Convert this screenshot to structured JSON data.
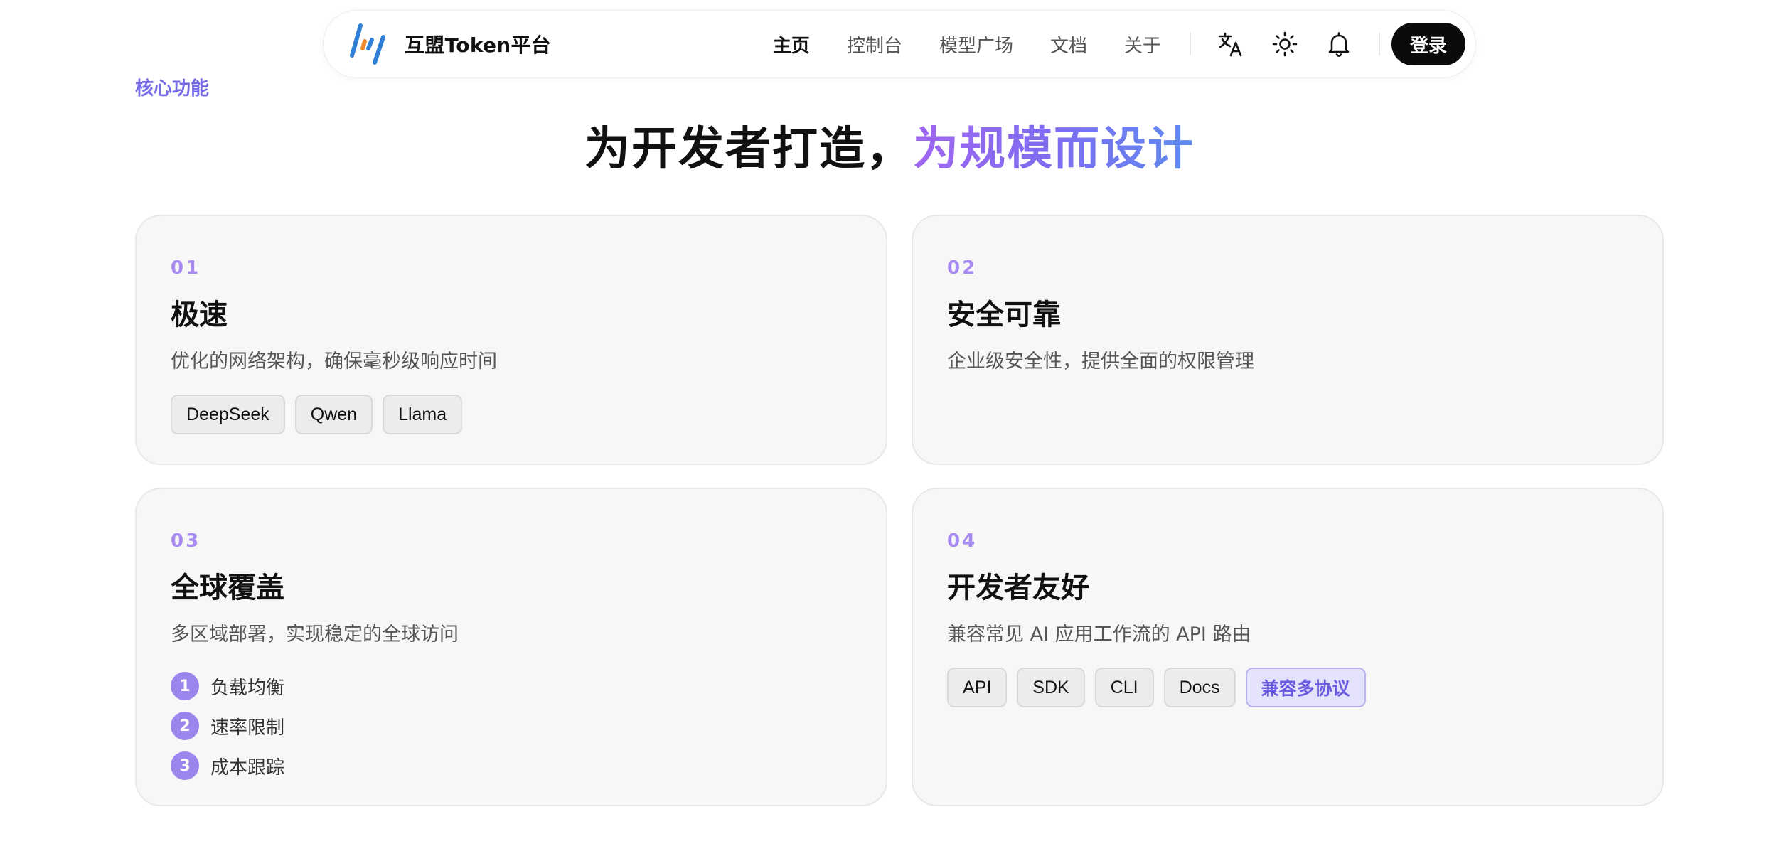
{
  "nav": {
    "brand_name": "互盟Token平台",
    "links": [
      {
        "label": "主页",
        "active": true
      },
      {
        "label": "控制台",
        "active": false
      },
      {
        "label": "模型广场",
        "active": false
      },
      {
        "label": "文档",
        "active": false
      },
      {
        "label": "关于",
        "active": false
      }
    ],
    "icons": [
      "translate-icon",
      "sun-icon",
      "bell-icon"
    ],
    "login_label": "登录"
  },
  "section": {
    "tag": "核心功能",
    "headline_plain": "为开发者打造，",
    "headline_accent": "为规模而设计"
  },
  "cards": [
    {
      "num": "01",
      "title": "极速",
      "desc": "优化的网络架构，确保毫秒级响应时间",
      "chips": [
        "DeepSeek",
        "Qwen",
        "Llama"
      ]
    },
    {
      "num": "02",
      "title": "安全可靠",
      "desc": "企业级安全性，提供全面的权限管理"
    },
    {
      "num": "03",
      "title": "全球覆盖",
      "desc": "多区域部署，实现稳定的全球访问",
      "steps": [
        {
          "num": "1",
          "label": "负载均衡"
        },
        {
          "num": "2",
          "label": "速率限制"
        },
        {
          "num": "3",
          "label": "成本跟踪"
        }
      ]
    },
    {
      "num": "04",
      "title": "开发者友好",
      "desc": "兼容常见 AI 应用工作流的 API 路由",
      "chips": [
        "API",
        "SDK",
        "CLI",
        "Docs"
      ],
      "accent_chip": "兼容多协议"
    }
  ],
  "colors": {
    "accent": "#7469e6",
    "gradient_start": "#a066f0",
    "gradient_end": "#5e8cf0",
    "card_bg": "#f7f7f7",
    "login_bg": "#0b0b0b"
  }
}
